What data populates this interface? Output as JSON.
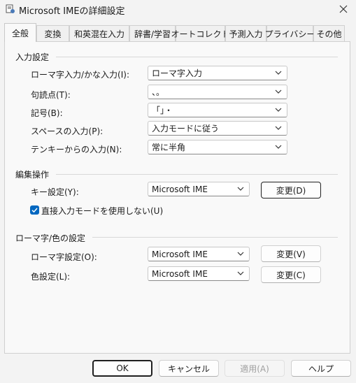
{
  "window": {
    "title": "Microsoft IMEの詳細設定"
  },
  "tabs": [
    {
      "label": "全般"
    },
    {
      "label": "変換"
    },
    {
      "label": "和英混在入力"
    },
    {
      "label": "辞書/学習"
    },
    {
      "label": "オートコレクト"
    },
    {
      "label": "予測入力"
    },
    {
      "label": "プライバシー"
    },
    {
      "label": "その他"
    }
  ],
  "input_settings": {
    "title": "入力設定",
    "rows": [
      {
        "label": "ローマ字入力/かな入力(I):",
        "value": "ローマ字入力"
      },
      {
        "label": "句読点(T):",
        "value": "、。"
      },
      {
        "label": "記号(B):",
        "value": "「」・"
      },
      {
        "label": "スペースの入力(P):",
        "value": "入力モードに従う"
      },
      {
        "label": "テンキーからの入力(N):",
        "value": "常に半角"
      }
    ]
  },
  "editing": {
    "title": "編集操作",
    "key_label": "キー設定(Y):",
    "key_value": "Microsoft IME",
    "change_button": "変更(D)",
    "checkbox_label": "直接入力モードを使用しない(U)",
    "checkbox_checked": true
  },
  "romaji_color": {
    "title": "ローマ字/色の設定",
    "romaji_label": "ローマ字設定(O):",
    "romaji_value": "Microsoft IME",
    "romaji_button": "変更(V)",
    "color_label": "色設定(L):",
    "color_value": "Microsoft IME",
    "color_button": "変更(C)"
  },
  "footer": {
    "ok": "OK",
    "cancel": "キャンセル",
    "apply": "適用(A)",
    "help": "ヘルプ"
  },
  "colors": {
    "accent": "#0067c0"
  }
}
